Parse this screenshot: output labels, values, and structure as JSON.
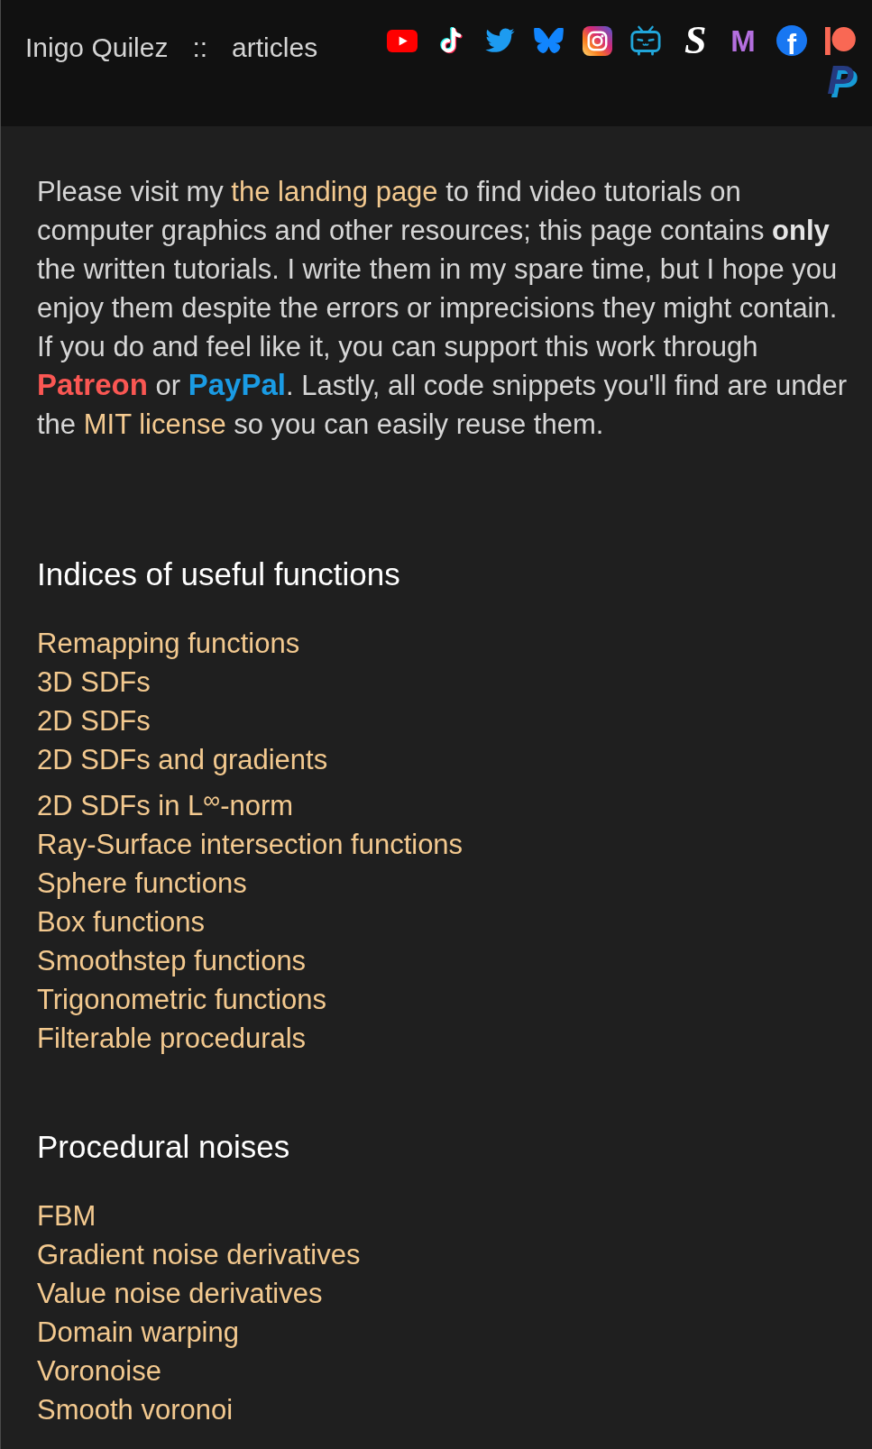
{
  "header": {
    "title": "Inigo Quilez",
    "separator": "::",
    "section": "articles",
    "icon_links": [
      {
        "kind": "play"
      },
      {
        "kind": "note"
      },
      {
        "kind": "bird"
      },
      {
        "kind": "butterfly"
      },
      {
        "kind": "camera"
      },
      {
        "kind": "tv"
      },
      {
        "kind": "script",
        "glyph": "S",
        "color": "#ffffff"
      },
      {
        "kind": "letter",
        "glyph": "M",
        "color": "#b46fdf"
      },
      {
        "kind": "badge",
        "glyph": "f",
        "color": "#1877f2"
      },
      {
        "kind": "bar"
      },
      {
        "kind": "slanted",
        "glyph": "P",
        "color": "#253b80"
      }
    ]
  },
  "intro": {
    "segments": [
      {
        "kind": "text",
        "text": "Please visit my "
      },
      {
        "kind": "link",
        "text": "the landing page"
      },
      {
        "kind": "text",
        "text": " to find video tutorials on computer graphics and other resources; this page contains **only** the written tutorials. I write them in my spare time, but I hope you enjoy them despite the errors or imprecisions they might contain. If you do and feel like it, you can support this work through "
      },
      {
        "kind": "brand",
        "text": "Patreon",
        "color": "#fa5753"
      },
      {
        "kind": "text",
        "text": " or "
      },
      {
        "kind": "brand",
        "text": "PayPal",
        "color": "#1a9be4"
      },
      {
        "kind": "text",
        "text": ". Lastly, all code snippets you'll find are under the "
      },
      {
        "kind": "link",
        "text": "MIT license"
      },
      {
        "kind": "text",
        "text": " so you can easily reuse them."
      }
    ]
  },
  "sections": [
    {
      "heading": "Indices of useful functions",
      "links": [
        "Remapping functions",
        "3D SDFs",
        "2D SDFs",
        "2D SDFs and gradients",
        "2D SDFs in L$^{∞}$-norm",
        "Ray-Surface intersection functions",
        "Sphere functions",
        "Box functions",
        "Smoothstep functions",
        "Trigonometric functions",
        "Filterable procedurals"
      ]
    },
    {
      "heading": "Procedural noises",
      "links": [
        "FBM",
        "Gradient noise derivatives",
        "Value noise derivatives",
        "Domain warping",
        "Voronoise",
        "Smooth voronoi"
      ]
    }
  ]
}
